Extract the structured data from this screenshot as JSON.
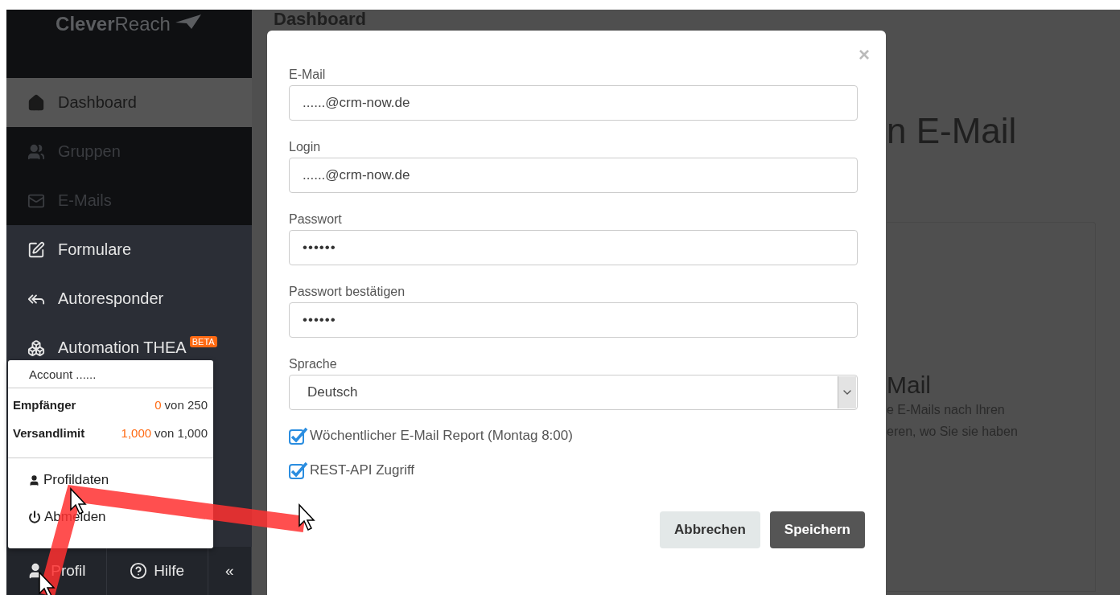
{
  "sidebar": {
    "logo": "**Clever**Reach",
    "items": [
      {
        "label": "Dashboard",
        "selected": true,
        "disabled": false
      },
      {
        "label": "Gruppen",
        "selected": false,
        "disabled": true
      },
      {
        "label": "E-Mails",
        "selected": false,
        "disabled": true
      },
      {
        "label": "Formulare",
        "selected": false,
        "disabled": false
      },
      {
        "label": "Autoresponder",
        "selected": false,
        "disabled": false
      },
      {
        "label": "Automation THEA",
        "selected": false,
        "disabled": false,
        "badge": "BETA"
      }
    ],
    "footer": {
      "profile": "Profil",
      "help": "Hilfe",
      "collapse": "«"
    }
  },
  "account_menu": {
    "title": "Account ......",
    "stats": [
      {
        "label": "Empfänger",
        "used": "0",
        "limit": "von 250"
      },
      {
        "label": "Versandlimit",
        "used": "1,000",
        "limit": "von 1,000"
      }
    ],
    "items": [
      "Profildaten",
      "Abmelden"
    ]
  },
  "main": {
    "heading": "Dashboard",
    "heading_2": "n E-Mail",
    "card": {
      "title": "Mail",
      "lines": [
        "e E-Mails nach Ihren",
        "eren, wo Sie sie haben"
      ]
    }
  },
  "modal": {
    "close": "×",
    "fields": [
      {
        "label": "E-Mail",
        "value": "......@crm-now.de",
        "kind": "text"
      },
      {
        "label": "Login",
        "value": "......@crm-now.de",
        "kind": "text"
      },
      {
        "label": "Passwort",
        "value": "••••••",
        "kind": "password"
      },
      {
        "label": "Passwort bestätigen",
        "value": "••••••",
        "kind": "password"
      },
      {
        "label": "Sprache",
        "value": "Deutsch",
        "kind": "select"
      }
    ],
    "checkboxes": [
      {
        "label": "Wöchentlicher E-Mail Report (Montag 8:00)",
        "checked": true
      },
      {
        "label": "REST-API Zugriff",
        "checked": true
      }
    ],
    "buttons": [
      {
        "label": "Abbrechen",
        "kind": "secondary"
      },
      {
        "label": "Speichern",
        "kind": "primary"
      }
    ]
  }
}
